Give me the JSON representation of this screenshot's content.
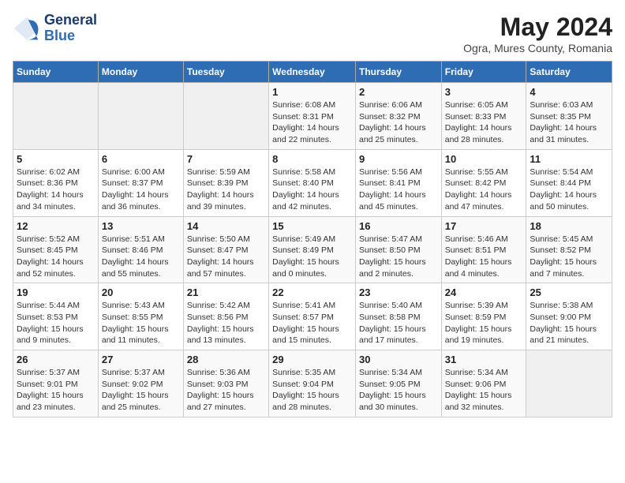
{
  "header": {
    "logo_general": "General",
    "logo_blue": "Blue",
    "month": "May 2024",
    "location": "Ogra, Mures County, Romania"
  },
  "days_of_week": [
    "Sunday",
    "Monday",
    "Tuesday",
    "Wednesday",
    "Thursday",
    "Friday",
    "Saturday"
  ],
  "weeks": [
    [
      null,
      null,
      null,
      {
        "day": 1,
        "sunrise": "6:08 AM",
        "sunset": "8:31 PM",
        "daylight": "14 hours and 22 minutes."
      },
      {
        "day": 2,
        "sunrise": "6:06 AM",
        "sunset": "8:32 PM",
        "daylight": "14 hours and 25 minutes."
      },
      {
        "day": 3,
        "sunrise": "6:05 AM",
        "sunset": "8:33 PM",
        "daylight": "14 hours and 28 minutes."
      },
      {
        "day": 4,
        "sunrise": "6:03 AM",
        "sunset": "8:35 PM",
        "daylight": "14 hours and 31 minutes."
      }
    ],
    [
      {
        "day": 5,
        "sunrise": "6:02 AM",
        "sunset": "8:36 PM",
        "daylight": "14 hours and 34 minutes."
      },
      {
        "day": 6,
        "sunrise": "6:00 AM",
        "sunset": "8:37 PM",
        "daylight": "14 hours and 36 minutes."
      },
      {
        "day": 7,
        "sunrise": "5:59 AM",
        "sunset": "8:39 PM",
        "daylight": "14 hours and 39 minutes."
      },
      {
        "day": 8,
        "sunrise": "5:58 AM",
        "sunset": "8:40 PM",
        "daylight": "14 hours and 42 minutes."
      },
      {
        "day": 9,
        "sunrise": "5:56 AM",
        "sunset": "8:41 PM",
        "daylight": "14 hours and 45 minutes."
      },
      {
        "day": 10,
        "sunrise": "5:55 AM",
        "sunset": "8:42 PM",
        "daylight": "14 hours and 47 minutes."
      },
      {
        "day": 11,
        "sunrise": "5:54 AM",
        "sunset": "8:44 PM",
        "daylight": "14 hours and 50 minutes."
      }
    ],
    [
      {
        "day": 12,
        "sunrise": "5:52 AM",
        "sunset": "8:45 PM",
        "daylight": "14 hours and 52 minutes."
      },
      {
        "day": 13,
        "sunrise": "5:51 AM",
        "sunset": "8:46 PM",
        "daylight": "14 hours and 55 minutes."
      },
      {
        "day": 14,
        "sunrise": "5:50 AM",
        "sunset": "8:47 PM",
        "daylight": "14 hours and 57 minutes."
      },
      {
        "day": 15,
        "sunrise": "5:49 AM",
        "sunset": "8:49 PM",
        "daylight": "15 hours and 0 minutes."
      },
      {
        "day": 16,
        "sunrise": "5:47 AM",
        "sunset": "8:50 PM",
        "daylight": "15 hours and 2 minutes."
      },
      {
        "day": 17,
        "sunrise": "5:46 AM",
        "sunset": "8:51 PM",
        "daylight": "15 hours and 4 minutes."
      },
      {
        "day": 18,
        "sunrise": "5:45 AM",
        "sunset": "8:52 PM",
        "daylight": "15 hours and 7 minutes."
      }
    ],
    [
      {
        "day": 19,
        "sunrise": "5:44 AM",
        "sunset": "8:53 PM",
        "daylight": "15 hours and 9 minutes."
      },
      {
        "day": 20,
        "sunrise": "5:43 AM",
        "sunset": "8:55 PM",
        "daylight": "15 hours and 11 minutes."
      },
      {
        "day": 21,
        "sunrise": "5:42 AM",
        "sunset": "8:56 PM",
        "daylight": "15 hours and 13 minutes."
      },
      {
        "day": 22,
        "sunrise": "5:41 AM",
        "sunset": "8:57 PM",
        "daylight": "15 hours and 15 minutes."
      },
      {
        "day": 23,
        "sunrise": "5:40 AM",
        "sunset": "8:58 PM",
        "daylight": "15 hours and 17 minutes."
      },
      {
        "day": 24,
        "sunrise": "5:39 AM",
        "sunset": "8:59 PM",
        "daylight": "15 hours and 19 minutes."
      },
      {
        "day": 25,
        "sunrise": "5:38 AM",
        "sunset": "9:00 PM",
        "daylight": "15 hours and 21 minutes."
      }
    ],
    [
      {
        "day": 26,
        "sunrise": "5:37 AM",
        "sunset": "9:01 PM",
        "daylight": "15 hours and 23 minutes."
      },
      {
        "day": 27,
        "sunrise": "5:37 AM",
        "sunset": "9:02 PM",
        "daylight": "15 hours and 25 minutes."
      },
      {
        "day": 28,
        "sunrise": "5:36 AM",
        "sunset": "9:03 PM",
        "daylight": "15 hours and 27 minutes."
      },
      {
        "day": 29,
        "sunrise": "5:35 AM",
        "sunset": "9:04 PM",
        "daylight": "15 hours and 28 minutes."
      },
      {
        "day": 30,
        "sunrise": "5:34 AM",
        "sunset": "9:05 PM",
        "daylight": "15 hours and 30 minutes."
      },
      {
        "day": 31,
        "sunrise": "5:34 AM",
        "sunset": "9:06 PM",
        "daylight": "15 hours and 32 minutes."
      },
      null
    ]
  ]
}
